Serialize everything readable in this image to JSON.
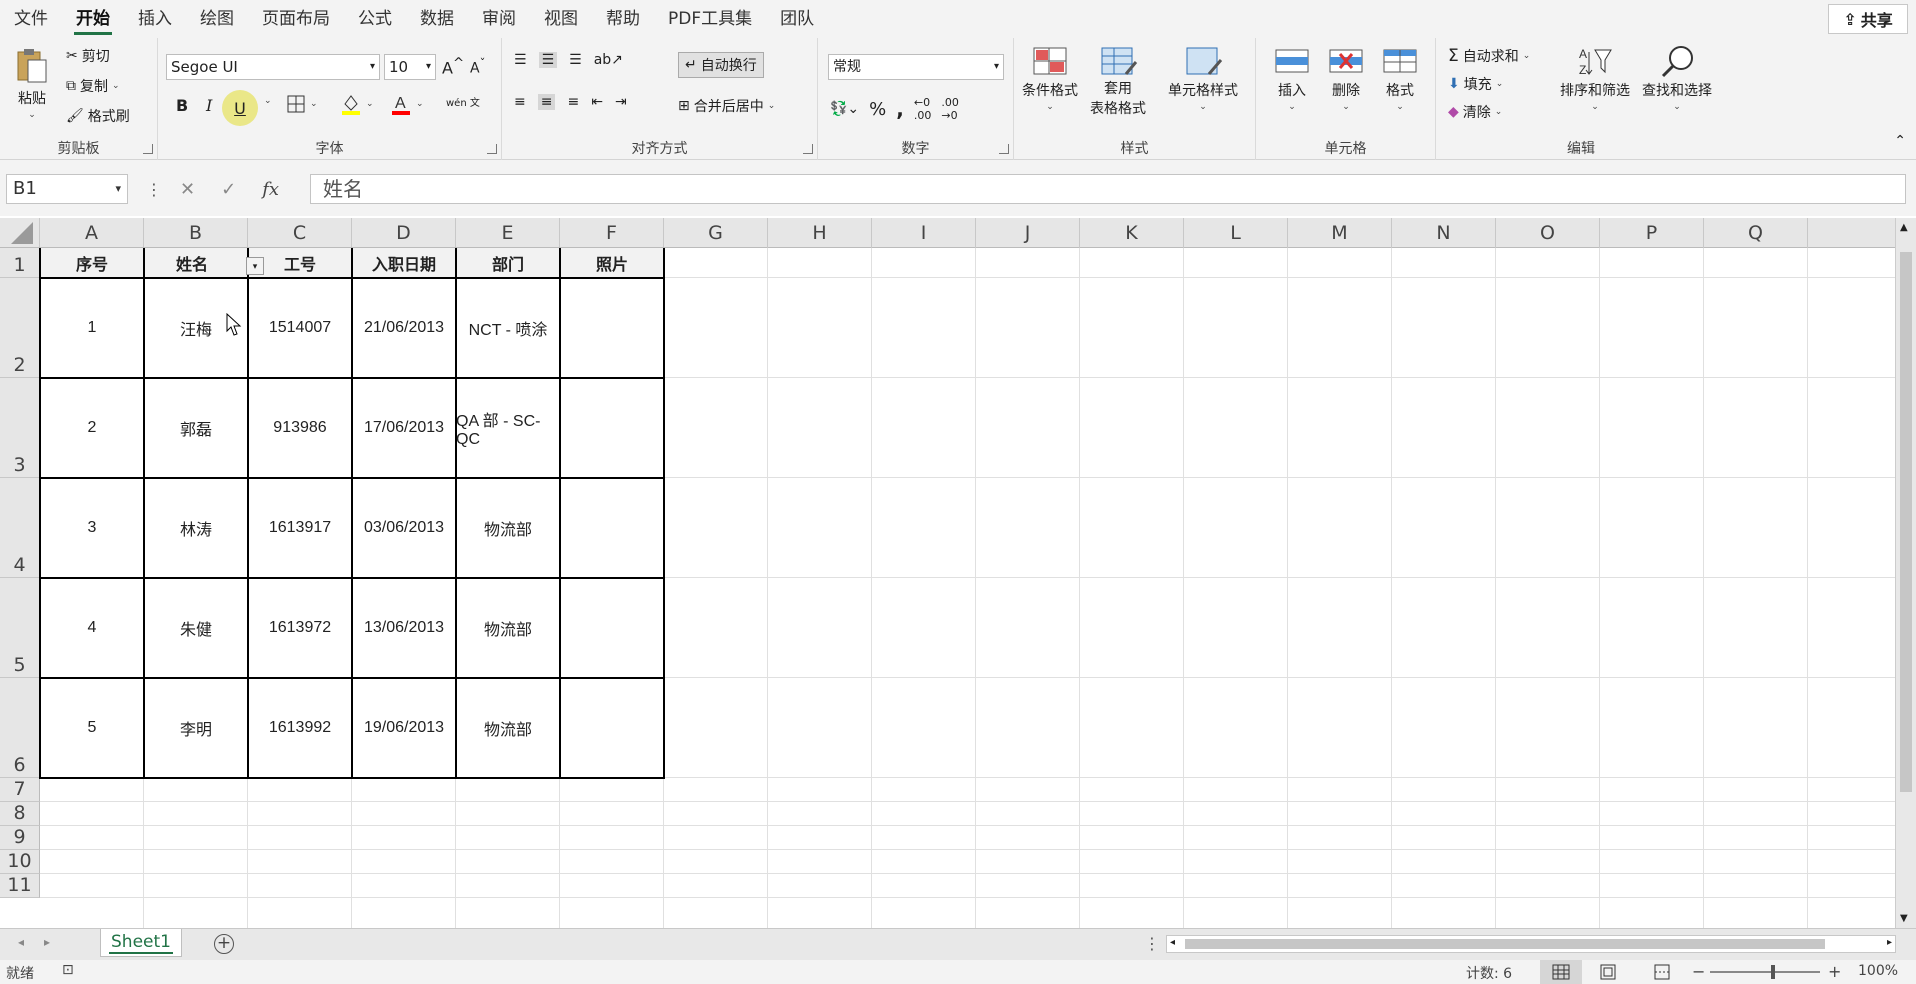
{
  "menu": {
    "tabs": [
      "文件",
      "开始",
      "插入",
      "绘图",
      "页面布局",
      "公式",
      "数据",
      "审阅",
      "视图",
      "帮助",
      "PDF工具集",
      "团队"
    ],
    "active": "开始",
    "share": "共享"
  },
  "ribbon": {
    "clipboard": {
      "paste": "粘贴",
      "cut": "剪切",
      "copy": "复制",
      "format_painter": "格式刷",
      "label": "剪贴板"
    },
    "font": {
      "family": "Segoe UI",
      "size": "10",
      "bold": "B",
      "italic": "I",
      "underline": "U",
      "label": "字体",
      "phonetic": "wén 文"
    },
    "alignment": {
      "wrap": "自动换行",
      "merge": "合并后居中",
      "label": "对齐方式"
    },
    "number": {
      "format": "常规",
      "percent": "%",
      "comma": ",",
      "label": "数字"
    },
    "styles": {
      "cond": "条件格式",
      "table": "套用",
      "table2": "表格格式",
      "cell": "单元格样式",
      "label": "样式"
    },
    "cells": {
      "insert": "插入",
      "delete": "删除",
      "format": "格式",
      "label": "单元格"
    },
    "editing": {
      "autosum": "自动求和",
      "fill": "填充",
      "clear": "清除",
      "sort": "排序和筛选",
      "find": "查找和选择",
      "label": "编辑"
    }
  },
  "formula_bar": {
    "name_box": "B1",
    "content": "姓名"
  },
  "columns": [
    "A",
    "B",
    "C",
    "D",
    "E",
    "F",
    "G",
    "H",
    "I",
    "J",
    "K",
    "L",
    "M",
    "N",
    "O",
    "P",
    "Q"
  ],
  "rows": [
    "1",
    "2",
    "3",
    "4",
    "5",
    "6",
    "7",
    "8",
    "9",
    "10",
    "11"
  ],
  "table": {
    "headers": [
      "序号",
      "姓名",
      "工号",
      "入职日期",
      "部门",
      "照片"
    ],
    "rows": [
      [
        "1",
        "汪梅",
        "1514007",
        "21/06/2013",
        "NCT - 喷涂",
        ""
      ],
      [
        "2",
        "郭磊",
        "913986",
        "17/06/2013",
        "QA 部 - SC-QC",
        ""
      ],
      [
        "3",
        "林涛",
        "1613917",
        "03/06/2013",
        "物流部",
        ""
      ],
      [
        "4",
        "朱健",
        "1613972",
        "13/06/2013",
        "物流部",
        ""
      ],
      [
        "5",
        "李明",
        "1613992",
        "19/06/2013",
        "物流部",
        ""
      ]
    ]
  },
  "sheet_tab": "Sheet1",
  "status": {
    "ready": "就绪",
    "count": "计数: 6",
    "zoom": "100%"
  },
  "colors": {
    "accent": "#217346",
    "yellow": "#ffff00",
    "red": "#ff0000"
  }
}
